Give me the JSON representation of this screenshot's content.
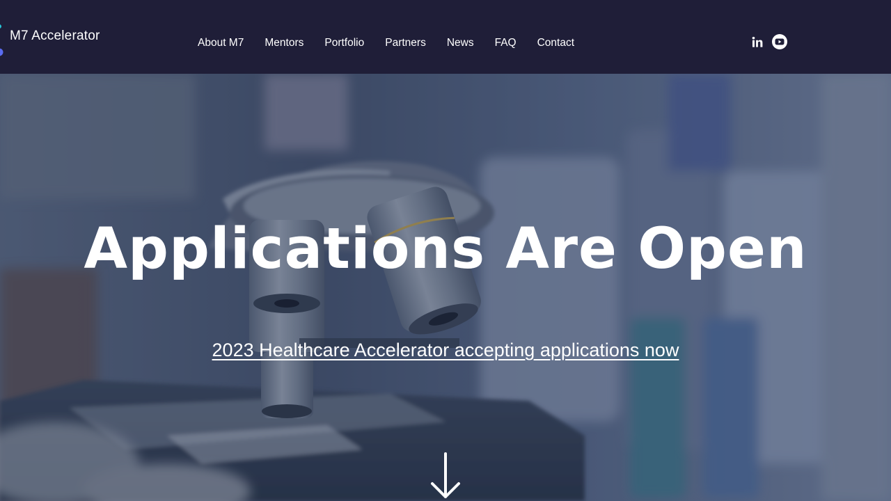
{
  "header": {
    "logo_text": "M7 Accelerator",
    "nav": [
      {
        "label": "About M7"
      },
      {
        "label": "Mentors"
      },
      {
        "label": "Portfolio"
      },
      {
        "label": "Partners"
      },
      {
        "label": "News"
      },
      {
        "label": "FAQ"
      },
      {
        "label": "Contact"
      }
    ],
    "social": [
      {
        "icon": "linkedin-icon"
      },
      {
        "icon": "youtube-icon"
      }
    ]
  },
  "hero": {
    "title": "Applications Are Open",
    "link_text": "2023 Healthcare Accelerator accepting applications now",
    "scroll_icon": "arrow-down-icon"
  },
  "colors": {
    "header_bg": "#1f1e38",
    "text": "#ffffff",
    "logo_accent_teal": "#28c6d8",
    "logo_accent_blue": "#5a6cf0"
  }
}
